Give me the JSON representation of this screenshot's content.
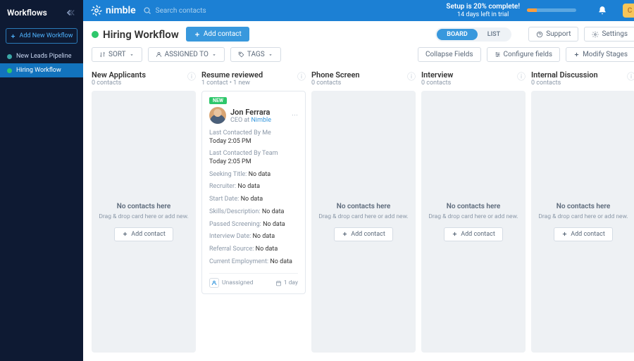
{
  "sidebar": {
    "title": "Workflows",
    "addBtn": "Add New Workflow",
    "items": [
      {
        "label": "New Leads Pipeline",
        "color": "#3aa6a6",
        "active": false
      },
      {
        "label": "Hiring Workflow",
        "color": "#2ec76b",
        "active": true
      }
    ]
  },
  "topbar": {
    "brand": "nimble",
    "searchPlaceholder": "Search contacts",
    "bannerTitle": "Setup is 20% complete!",
    "bannerSub": "14 days left in trial",
    "progressPct": 20,
    "avatarInitial": "C"
  },
  "header": {
    "title": "Hiring Workflow",
    "addContact": "Add contact",
    "viewBoard": "BOARD",
    "viewList": "LIST",
    "support": "Support",
    "settings": "Settings"
  },
  "filters": {
    "sort": "SORT",
    "assigned": "ASSIGNED TO",
    "tags": "TAGS",
    "collapse": "Collapse Fields",
    "configure": "Configure fields",
    "modify": "Modify Stages"
  },
  "empty": {
    "heading": "No contacts here",
    "sub": "Drag & drop card here or add new.",
    "addBtn": "Add contact"
  },
  "stages": [
    {
      "title": "New Applicants",
      "sub": "0 contacts"
    },
    {
      "title": "Resume reviewed",
      "sub": "1 contact • 1 new"
    },
    {
      "title": "Phone Screen",
      "sub": "0 contacts"
    },
    {
      "title": "Interview",
      "sub": "0 contacts"
    },
    {
      "title": "Internal Discussion",
      "sub": "0 contacts"
    }
  ],
  "card": {
    "newBadge": "NEW",
    "name": "Jon Ferrara",
    "rolePrefix": "CEO at ",
    "company": "Nimble",
    "fields": [
      {
        "label": "Last Contacted By Me",
        "value": "Today 2:05 PM"
      },
      {
        "label": "Last Contacted By Team",
        "value": "Today 2:05 PM"
      },
      {
        "label": "Seeking Title:",
        "value": "No data",
        "inline": true
      },
      {
        "label": "Recruiter:",
        "value": "No data",
        "inline": true
      },
      {
        "label": "Start Date:",
        "value": "No data",
        "inline": true
      },
      {
        "label": "Skills/Description:",
        "value": "No data",
        "inline": true
      },
      {
        "label": "Passed Screening:",
        "value": "No data",
        "inline": true
      },
      {
        "label": "Interview Date:",
        "value": "No data",
        "inline": true
      },
      {
        "label": "Referral Source:",
        "value": "No data",
        "inline": true
      },
      {
        "label": "Current Employment:",
        "value": "No data",
        "inline": true
      }
    ],
    "assigned": "Unassigned",
    "age": "1 day"
  }
}
